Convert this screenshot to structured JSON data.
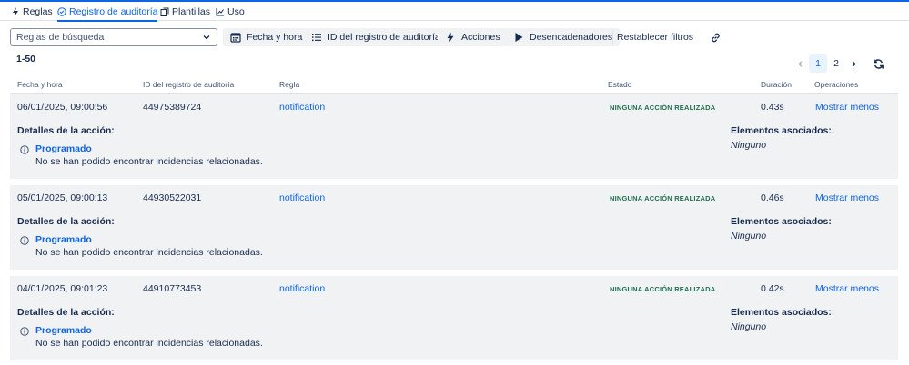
{
  "tabs": [
    {
      "label": "Reglas",
      "icon": "bolt-icon",
      "active": false
    },
    {
      "label": "Registro de auditoría",
      "icon": "check-circle-icon",
      "active": true
    },
    {
      "label": "Plantillas",
      "icon": "copy-icon",
      "active": false
    },
    {
      "label": "Uso",
      "icon": "chart-icon",
      "active": false
    }
  ],
  "toolbar": {
    "search_placeholder": "Reglas de búsqueda",
    "date_label": "Fecha y hora",
    "id_label": "ID del registro de auditoría",
    "actions_label": "Acciones",
    "triggers_label": "Desencadenadores",
    "reset_label": "Restablecer filtros"
  },
  "range_label": "1-50",
  "pagination": {
    "pages": [
      "1",
      "2"
    ],
    "current": "1"
  },
  "columns": [
    "Fecha y hora",
    "ID del registro de auditoría",
    "Regla",
    "Estado",
    "Duración",
    "Operaciones"
  ],
  "rows": [
    {
      "date": "06/01/2025, 09:00:56",
      "id": "44975389724",
      "rule": "notification",
      "status": "NINGUNA ACCIÓN REALIZADA",
      "duration": "0.43s",
      "operation": "Mostrar menos",
      "details_title": "Detalles de la acción:",
      "action_name": "Programado",
      "action_message": "No se han podido encontrar incidencias relacionadas.",
      "assoc_title": "Elementos asociados:",
      "assoc_value": "Ninguno"
    },
    {
      "date": "05/01/2025, 09:00:13",
      "id": "44930522031",
      "rule": "notification",
      "status": "NINGUNA ACCIÓN REALIZADA",
      "duration": "0.46s",
      "operation": "Mostrar menos",
      "details_title": "Detalles de la acción:",
      "action_name": "Programado",
      "action_message": "No se han podido encontrar incidencias relacionadas.",
      "assoc_title": "Elementos asociados:",
      "assoc_value": "Ninguno"
    },
    {
      "date": "04/01/2025, 09:01:23",
      "id": "44910773453",
      "rule": "notification",
      "status": "NINGUNA ACCIÓN REALIZADA",
      "duration": "0.42s",
      "operation": "Mostrar menos",
      "details_title": "Detalles de la acción:",
      "action_name": "Programado",
      "action_message": "No se han podido encontrar incidencias relacionadas.",
      "assoc_title": "Elementos asociados:",
      "assoc_value": "Ninguno"
    }
  ],
  "colors": {
    "accent": "#0c66e4",
    "status_green": "#216e4e",
    "row_bg": "#f1f2f4"
  }
}
